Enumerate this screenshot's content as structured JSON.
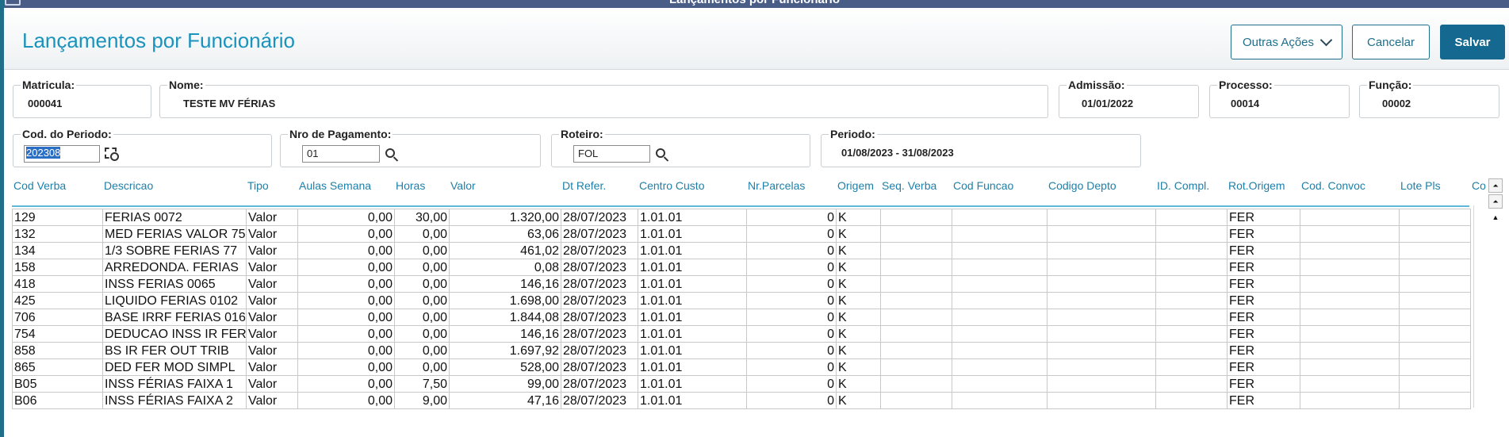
{
  "window": {
    "title": "Lançamentos por Funcionário"
  },
  "page": {
    "title": "Lançamentos por Funcionário"
  },
  "actions": {
    "outras": "Outras Ações",
    "cancelar": "Cancelar",
    "salvar": "Salvar"
  },
  "fields": {
    "matricula": {
      "label": "Matricula:",
      "value": "000041"
    },
    "nome": {
      "label": "Nome:",
      "value": "TESTE MV FÉRIAS"
    },
    "admissao": {
      "label": "Admissão:",
      "value": "01/01/2022"
    },
    "processo": {
      "label": "Processo:",
      "value": "00014"
    },
    "funcao": {
      "label": "Função:",
      "value": "00002"
    },
    "cod_periodo": {
      "label": "Cod. do Periodo:",
      "value": "202308"
    },
    "nro_pagamento": {
      "label": "Nro de Pagamento:",
      "value": "01"
    },
    "roteiro": {
      "label": "Roteiro:",
      "value": "FOL"
    },
    "periodo": {
      "label": "Periodo:",
      "value": "01/08/2023 - 31/08/2023"
    }
  },
  "icons": {
    "calendar": "calendar-search-icon",
    "search": "magnifier-icon"
  },
  "table": {
    "columns": [
      "Cod Verba",
      "Descricao",
      "Tipo",
      "Aulas Semana",
      "Horas",
      "Valor",
      "Dt Refer.",
      "Centro Custo",
      "Nr.Parcelas",
      "Origem",
      "Seq. Verba",
      "Cod Funcao",
      "Codigo Depto",
      "ID. Compl.",
      "Rot.Origem",
      "Cod. Convoc",
      "Lote Pls",
      "Co"
    ],
    "rows": [
      [
        "129",
        "FERIAS 0072",
        "Valor",
        "0,00",
        "30,00",
        "1.320,00",
        "28/07/2023",
        "1.01.01",
        "0",
        "K",
        "",
        "",
        "",
        "",
        "FER",
        "",
        ""
      ],
      [
        "132",
        "MED FERIAS VALOR  75",
        "Valor",
        "0,00",
        "0,00",
        "63,06",
        "28/07/2023",
        "1.01.01",
        "0",
        "K",
        "",
        "",
        "",
        "",
        "FER",
        "",
        ""
      ],
      [
        "134",
        "1/3 SOBRE FERIAS 77",
        "Valor",
        "0,00",
        "0,00",
        "461,02",
        "28/07/2023",
        "1.01.01",
        "0",
        "K",
        "",
        "",
        "",
        "",
        "FER",
        "",
        ""
      ],
      [
        "158",
        "ARREDONDA. FERIAS",
        "Valor",
        "0,00",
        "0,00",
        "0,08",
        "28/07/2023",
        "1.01.01",
        "0",
        "K",
        "",
        "",
        "",
        "",
        "FER",
        "",
        ""
      ],
      [
        "418",
        "INSS FERIAS 0065",
        "Valor",
        "0,00",
        "0,00",
        "146,16",
        "28/07/2023",
        "1.01.01",
        "0",
        "K",
        "",
        "",
        "",
        "",
        "FER",
        "",
        ""
      ],
      [
        "425",
        "LIQUIDO FERIAS 0102",
        "Valor",
        "0,00",
        "0,00",
        "1.698,00",
        "28/07/2023",
        "1.01.01",
        "0",
        "K",
        "",
        "",
        "",
        "",
        "FER",
        "",
        ""
      ],
      [
        "706",
        "BASE IRRF FERIAS 016",
        "Valor",
        "0,00",
        "0,00",
        "1.844,08",
        "28/07/2023",
        "1.01.01",
        "0",
        "K",
        "",
        "",
        "",
        "",
        "FER",
        "",
        ""
      ],
      [
        "754",
        "DEDUCAO INSS IR FERI",
        "Valor",
        "0,00",
        "0,00",
        "146,16",
        "28/07/2023",
        "1.01.01",
        "0",
        "K",
        "",
        "",
        "",
        "",
        "FER",
        "",
        ""
      ],
      [
        "858",
        "BS IR FER OUT TRIB",
        "Valor",
        "0,00",
        "0,00",
        "1.697,92",
        "28/07/2023",
        "1.01.01",
        "0",
        "K",
        "",
        "",
        "",
        "",
        "FER",
        "",
        ""
      ],
      [
        "865",
        "DED FER MOD SIMPL",
        "Valor",
        "0,00",
        "0,00",
        "528,00",
        "28/07/2023",
        "1.01.01",
        "0",
        "K",
        "",
        "",
        "",
        "",
        "FER",
        "",
        ""
      ],
      [
        "B05",
        "INSS FÉRIAS FAIXA 1",
        "Valor",
        "0,00",
        "7,50",
        "99,00",
        "28/07/2023",
        "1.01.01",
        "0",
        "K",
        "",
        "",
        "",
        "",
        "FER",
        "",
        ""
      ],
      [
        "B06",
        "INSS FÉRIAS FAIXA 2",
        "Valor",
        "0,00",
        "9,00",
        "47,16",
        "28/07/2023",
        "1.01.01",
        "0",
        "K",
        "",
        "",
        "",
        "",
        "FER",
        "",
        ""
      ]
    ]
  },
  "scroll": {
    "first": "⏶",
    "prev_page": "⏶",
    "prev": "▲"
  },
  "colors": {
    "accent": "#1a93bd",
    "primary_button": "#156890",
    "header_text": "#1f7fa8"
  }
}
